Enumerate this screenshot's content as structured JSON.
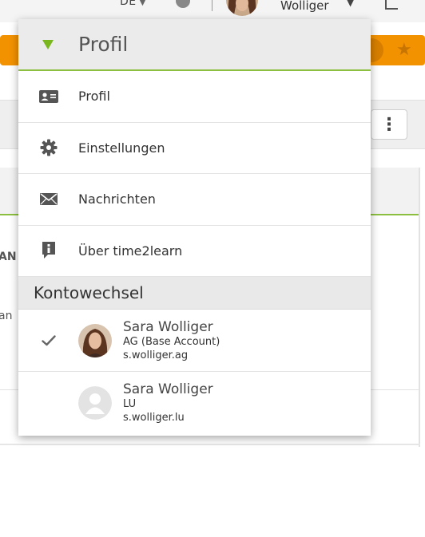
{
  "topbar": {
    "language": "DE",
    "user_name": "Wolliger"
  },
  "colors": {
    "accent_green": "#8cbf3f",
    "toolbar_orange": "#f39200"
  },
  "background": {
    "fragment_1": "AN",
    "fragment_2": "an"
  },
  "dropdown": {
    "title": "Profil",
    "items": [
      {
        "label": "Profil",
        "icon": "id-card-icon"
      },
      {
        "label": "Einstellungen",
        "icon": "gear-icon"
      },
      {
        "label": "Nachrichten",
        "icon": "envelope-icon"
      },
      {
        "label": "Über time2learn",
        "icon": "info-icon"
      }
    ],
    "section_title": "Kontowechsel",
    "accounts": [
      {
        "name": "Sara Wolliger",
        "org": "AG (Base Account)",
        "username": "s.wolliger.ag",
        "active": true
      },
      {
        "name": "Sara Wolliger",
        "org": "LU",
        "username": "s.wolliger.lu",
        "active": false
      }
    ]
  }
}
